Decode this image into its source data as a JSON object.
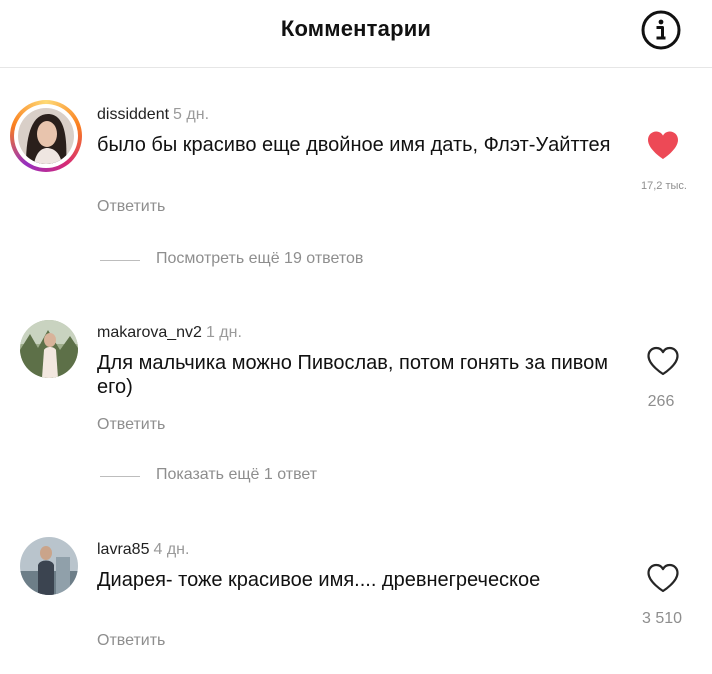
{
  "header": {
    "title": "Комментарии",
    "info_icon": "info-icon"
  },
  "comments": [
    {
      "username": "dissiddent",
      "time": "5 дн.",
      "text": "было бы красиво еще двойное имя дать, Флэт-Уайттея",
      "reply_label": "Ответить",
      "likes": "17,2 тыс.",
      "liked": true,
      "thread_link": "Посмотреть ещё 19 ответов"
    },
    {
      "username": "makarova_nv2",
      "time": "1 дн.",
      "text": "Для мальчика можно Пивослав, потом гонять за пивом его)",
      "reply_label": "Ответить",
      "likes": "266",
      "liked": false,
      "thread_link": "Показать ещё 1 ответ"
    },
    {
      "username": "lavra85",
      "time": "4 дн.",
      "text": "Диарея- тоже красивое имя.... древнегреческое",
      "reply_label": "Ответить",
      "likes": "3 510",
      "liked": false
    }
  ],
  "colors": {
    "liked_heart": "#ed4956",
    "secondary_text": "#8e8e8e"
  }
}
